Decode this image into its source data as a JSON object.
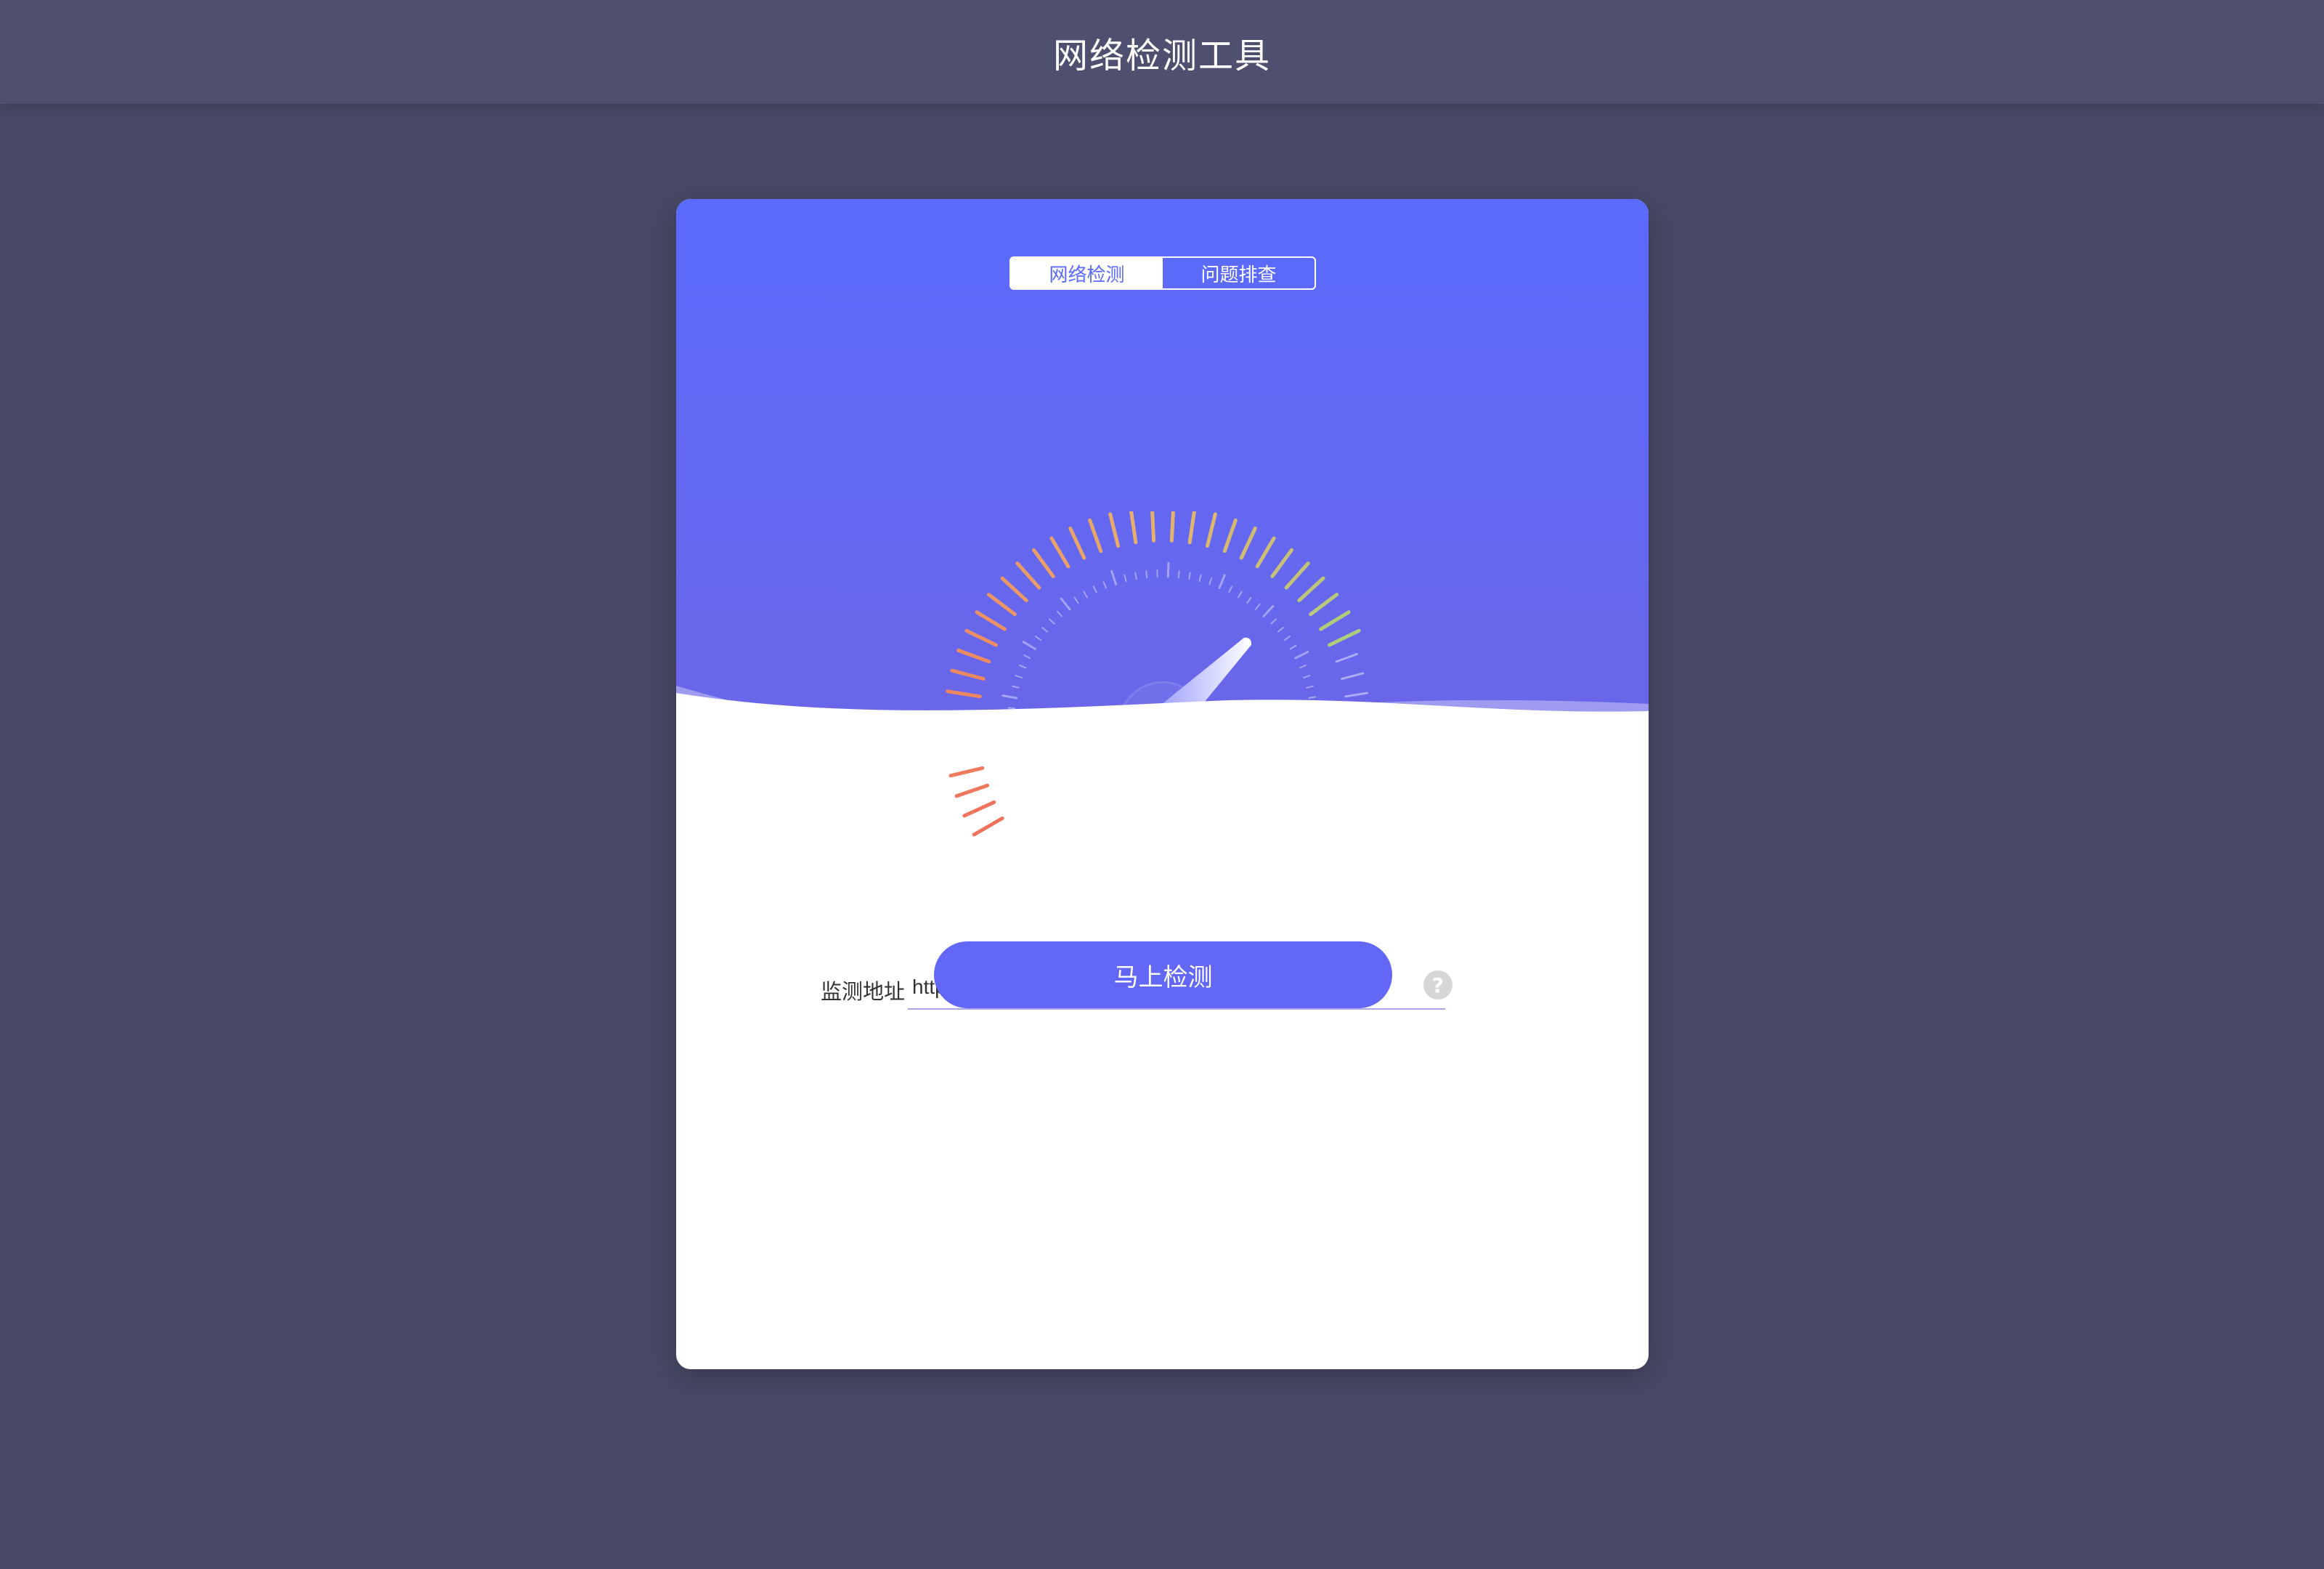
{
  "header": {
    "title": "网络检测工具"
  },
  "tabs": [
    {
      "label": "网络检测",
      "active": true
    },
    {
      "label": "问题排查",
      "active": false
    }
  ],
  "gauge": {
    "level": 0.78,
    "colors": {
      "low": "#f0715c",
      "mid": "#e7b16d",
      "high": "#7ee48a"
    }
  },
  "form": {
    "label": "监测地址",
    "url_value": "http://10.242.100.195:1188/",
    "help_icon": "question-icon"
  },
  "actions": {
    "start_label": "马上检测"
  },
  "colors": {
    "background": "#484965",
    "header": "#4f506f",
    "accent": "#5a6afc",
    "button": "#6268f5"
  }
}
